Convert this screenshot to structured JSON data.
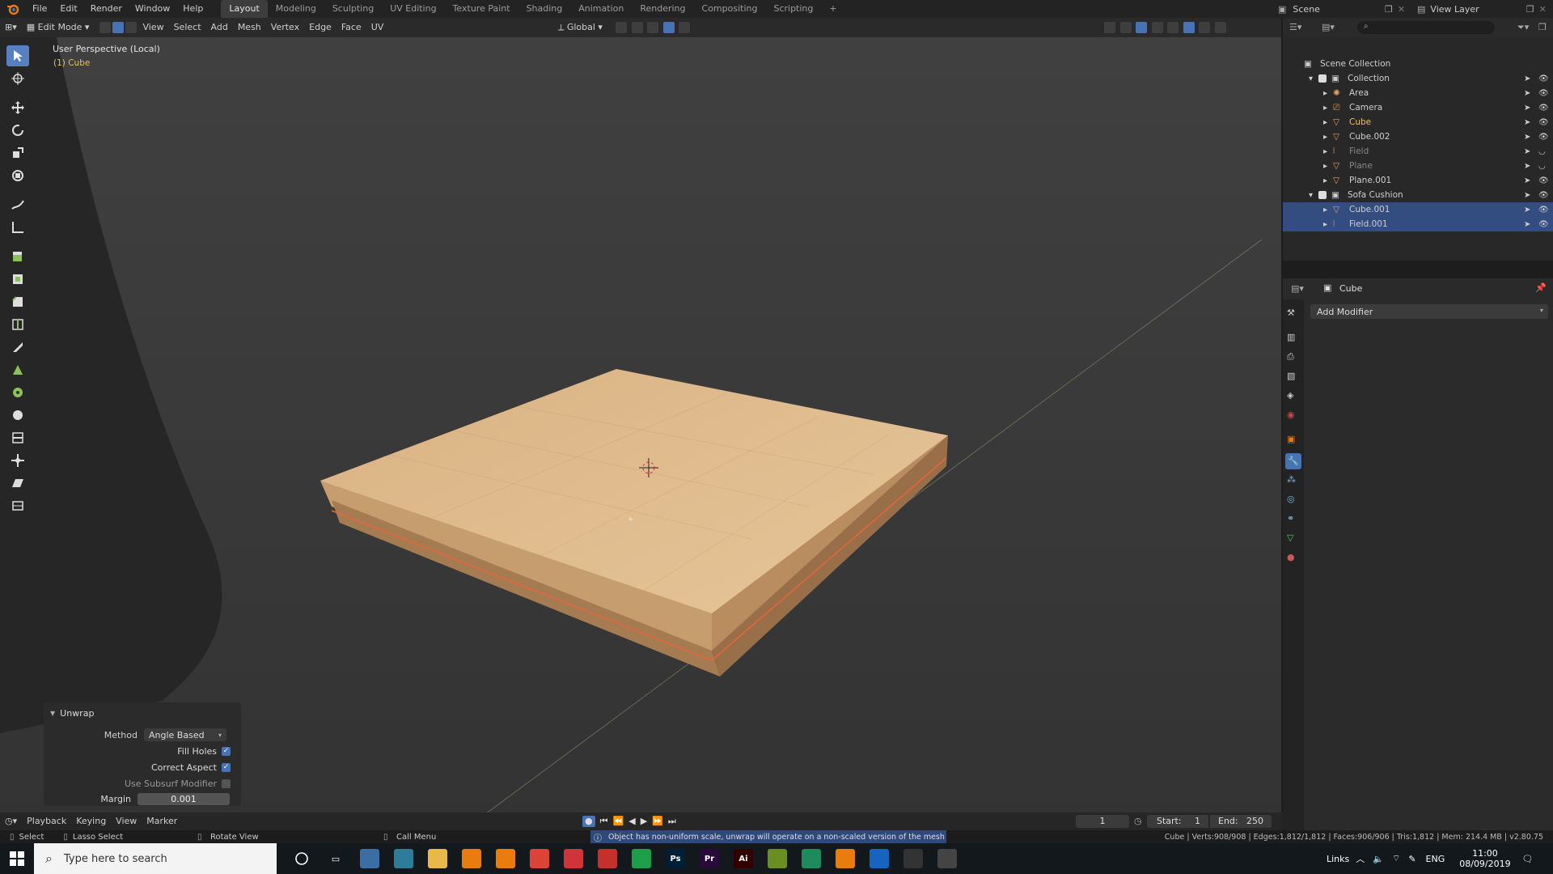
{
  "topbar": {
    "menus": [
      "File",
      "Edit",
      "Render",
      "Window",
      "Help"
    ],
    "workspaces": [
      "Layout",
      "Modeling",
      "Sculpting",
      "UV Editing",
      "Texture Paint",
      "Shading",
      "Animation",
      "Rendering",
      "Compositing",
      "Scripting"
    ],
    "add_tab": "+",
    "scene_label": "Scene",
    "view_layer_label": "View Layer"
  },
  "viewport_header": {
    "mode": "Edit Mode",
    "menus": [
      "View",
      "Select",
      "Add",
      "Mesh",
      "Vertex",
      "Edge",
      "Face",
      "UV"
    ],
    "orientation": "Global"
  },
  "viewport": {
    "perspective": "User Perspective (Local)",
    "object": "(1) Cube"
  },
  "unwrap": {
    "title": "Unwrap",
    "method_label": "Method",
    "method_value": "Angle Based",
    "fill_holes": "Fill Holes",
    "correct_aspect": "Correct Aspect",
    "use_subsurf": "Use Subsurf Modifier",
    "margin_label": "Margin",
    "margin_value": "0.001"
  },
  "outliner": {
    "search_placeholder": "",
    "rows": [
      {
        "label": "Scene Collection",
        "indent": 0
      },
      {
        "label": "Collection",
        "indent": 1
      },
      {
        "label": "Area",
        "indent": 2
      },
      {
        "label": "Camera",
        "indent": 2
      },
      {
        "label": "Cube",
        "indent": 2
      },
      {
        "label": "Cube.002",
        "indent": 2
      },
      {
        "label": "Field",
        "indent": 2
      },
      {
        "label": "Plane",
        "indent": 2
      },
      {
        "label": "Plane.001",
        "indent": 2
      },
      {
        "label": "Sofa Cushion",
        "indent": 1
      },
      {
        "label": "Cube.001",
        "indent": 2
      },
      {
        "label": "Field.001",
        "indent": 2
      }
    ]
  },
  "properties": {
    "object_name": "Cube",
    "add_modifier": "Add Modifier"
  },
  "timeline": {
    "playback": "Playback",
    "keying": "Keying",
    "view": "View",
    "marker": "Marker",
    "current_frame": "1",
    "start_label": "Start:",
    "start_value": "1",
    "end_label": "End:",
    "end_value": "250"
  },
  "statusbar": {
    "select": "Select",
    "lasso": "Lasso Select",
    "rotate": "Rotate View",
    "call_menu": "Call Menu",
    "warning": "Object has non-uniform scale, unwrap will operate on a non-scaled version of the mesh",
    "stats": "Cube | Verts:908/908 | Edges:1,812/1,812 | Faces:906/906 | Tris:1,812 | Mem: 214.4 MB | v2.80.75"
  },
  "taskbar": {
    "search_placeholder": "Type here to search",
    "links": "Links",
    "lang": "ENG",
    "time": "11:00",
    "date": "08/09/2019",
    "apps": [
      {
        "label": "",
        "color": "#3a6ea5"
      },
      {
        "label": "",
        "color": "#2d7d9a"
      },
      {
        "label": "",
        "color": "#e8b84a"
      },
      {
        "label": "",
        "color": "#e87d0d"
      },
      {
        "label": "",
        "color": "#e87d0d"
      },
      {
        "label": "",
        "color": "#db4437"
      },
      {
        "label": "",
        "color": "#d13438"
      },
      {
        "label": "",
        "color": "#c4302b"
      },
      {
        "label": "",
        "color": "#1e9e4a"
      },
      {
        "label": "Ps",
        "color": "#001e36"
      },
      {
        "label": "Pr",
        "color": "#2a0a3a"
      },
      {
        "label": "Ai",
        "color": "#330000"
      },
      {
        "label": "",
        "color": "#6b8e23"
      },
      {
        "label": "",
        "color": "#1f8a5b"
      },
      {
        "label": "",
        "color": "#e87d0d"
      },
      {
        "label": "",
        "color": "#1565c0"
      },
      {
        "label": "",
        "color": "#333"
      },
      {
        "label": "",
        "color": "#444"
      }
    ]
  },
  "colors": {
    "accent": "#4772b3",
    "object": "#e0b080",
    "selected": "#334d80"
  }
}
